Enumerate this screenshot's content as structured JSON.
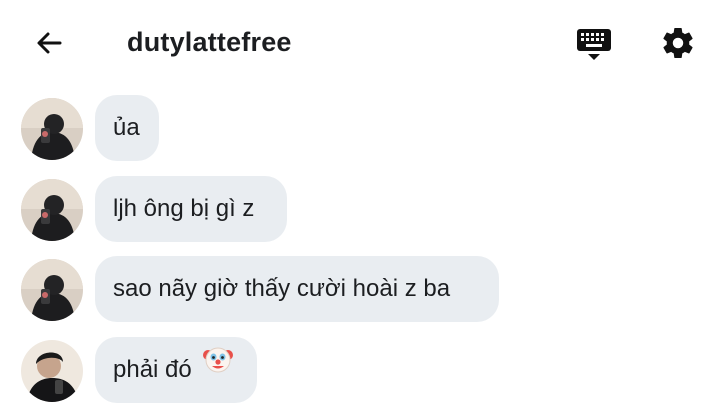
{
  "header": {
    "title": "dutylattefree",
    "back_icon": "arrow-left-icon",
    "keyboard_icon": "keyboard-icon",
    "settings_icon": "gear-icon"
  },
  "messages": [
    {
      "text": "ủa",
      "sender": "other"
    },
    {
      "text": "ljh ông bị gì z",
      "sender": "other"
    },
    {
      "text": "sao nãy giờ thấy cười hoài z ba",
      "sender": "other"
    },
    {
      "text": "phải đó",
      "emoji": "clown-face-icon",
      "sender": "reply"
    }
  ],
  "colors": {
    "bubble": "#e9edf1",
    "text": "#1c1e21",
    "icon": "#111111"
  }
}
